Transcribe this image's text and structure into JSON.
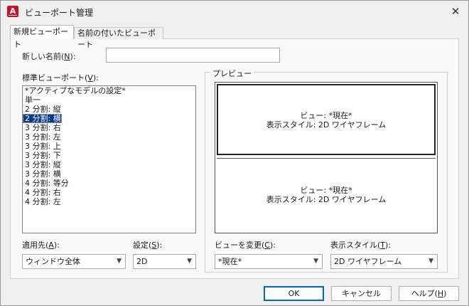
{
  "window": {
    "title": "ビューポート管理",
    "close_glyph": "✕",
    "app_icon_letter": "A"
  },
  "tabs": [
    {
      "label": "新規ビューポート",
      "active": true
    },
    {
      "label": "名前の付いたビューポート",
      "active": false
    }
  ],
  "new_name": {
    "label": "新しい名前(",
    "key": "N",
    "label_end": "):",
    "value": ""
  },
  "standard": {
    "label": "標準ビューポート(",
    "key": "V",
    "label_end": "):",
    "items": [
      "*アクティブなモデルの設定*",
      "単一",
      "2 分割: 縦",
      "2 分割: 横",
      "3 分割: 右",
      "3 分割: 左",
      "3 分割: 上",
      "3 分割: 下",
      "3 分割: 縦",
      "3 分割: 横",
      "4 分割: 等分",
      "4 分割: 右",
      "4 分割: 左"
    ],
    "selected_index": 3
  },
  "preview": {
    "title": "プレビュー",
    "top": {
      "line1": "ビュー: *現在*",
      "line2": "表示スタイル: 2D ワイヤフレーム"
    },
    "bottom": {
      "line1": "ビュー: *現在*",
      "line2": "表示スタイル: 2D ワイヤフレーム"
    }
  },
  "apply_to": {
    "label": "適用先(",
    "key": "A",
    "label_end": "):",
    "value": "ウィンドウ全体"
  },
  "setup": {
    "label": "設定(",
    "key": "S",
    "label_end": "):",
    "value": "2D"
  },
  "change_view": {
    "label": "ビューを変更(",
    "key": "C",
    "label_end": "):",
    "value": "*現在*"
  },
  "visual_style": {
    "label": "表示スタイル(",
    "key": "T",
    "label_end": "):",
    "value": "2D ワイヤフレーム"
  },
  "buttons": {
    "ok": "OK",
    "cancel": "キャンセル",
    "help_prefix": "ヘルプ(",
    "help_key": "H",
    "help_suffix": ")"
  },
  "colors": {
    "selection": "#0b3a8c",
    "default_button_border": "#0067c0",
    "app_icon": "#c8102e"
  }
}
